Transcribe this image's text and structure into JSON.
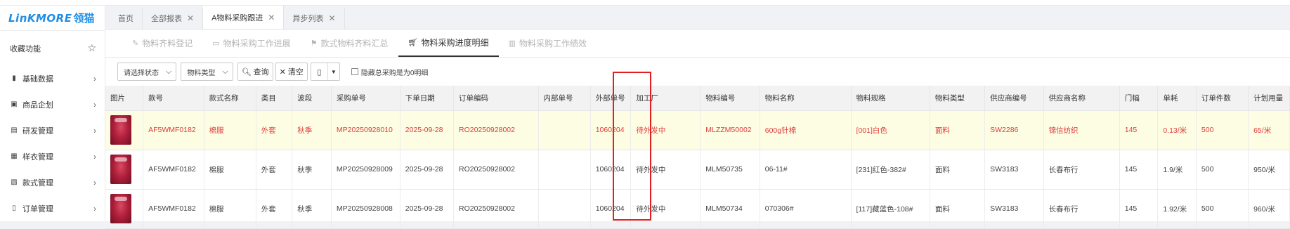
{
  "logo": {
    "brand": "LinKMORE",
    "brand_cn": "领猫"
  },
  "sidebar": {
    "favorite": {
      "label": "收藏功能",
      "icon": "star-icon"
    },
    "items": [
      {
        "label": "基础数据",
        "icon": "book-icon"
      },
      {
        "label": "商品企划",
        "icon": "calendar-icon"
      },
      {
        "label": "研发管理",
        "icon": "rd-icon"
      },
      {
        "label": "样衣管理",
        "icon": "sample-card-icon"
      },
      {
        "label": "款式管理",
        "icon": "style-icon"
      },
      {
        "label": "订单管理",
        "icon": "document-icon"
      }
    ]
  },
  "tabs": [
    {
      "label": "首页",
      "closable": false,
      "active": false
    },
    {
      "label": "全部报表",
      "closable": true,
      "active": false
    },
    {
      "label": "A物料采购跟进",
      "closable": true,
      "active": true
    },
    {
      "label": "异步列表",
      "closable": true,
      "active": false
    }
  ],
  "subtabs": [
    {
      "label": "物料齐料登记",
      "icon": "edit-icon",
      "active": false
    },
    {
      "label": "物料采购工作进展",
      "icon": "monitor-icon",
      "active": false
    },
    {
      "label": "款式物料齐料汇总",
      "icon": "flag-icon",
      "active": false
    },
    {
      "label": "物料采购进度明细",
      "icon": "cart-icon",
      "active": true
    },
    {
      "label": "物料采购工作绩效",
      "icon": "book-open-icon",
      "active": false
    }
  ],
  "toolbar": {
    "status_select": "请选择状态",
    "type_select": "物料类型",
    "query_label": "查询",
    "clear_label": "清空",
    "hide_zero_label": "隐藏总采购是为0明细"
  },
  "table": {
    "columns": [
      "图片",
      "款号",
      "款式名称",
      "类目",
      "波段",
      "采购单号",
      "下单日期",
      "订单编码",
      "内部单号",
      "外部单号",
      "加工厂",
      "物料编号",
      "物料名称",
      "物料规格",
      "物料类型",
      "供应商编号",
      "供应商名称",
      "门幅",
      "单耗",
      "订单件数",
      "计划用量"
    ],
    "rows": [
      {
        "highlight": true,
        "cells": [
          "",
          "AF5WMF0182",
          "棉服",
          "外套",
          "秋季",
          "MP20250928010",
          "2025-09-28",
          "RO20250928002",
          "",
          "1060204",
          "待外发中",
          "MLZZM50002",
          "600g针棉",
          "[001]白色",
          "面料",
          "SW2286",
          "锦信纺织",
          "145",
          "0.13/米",
          "500",
          "65/米"
        ]
      },
      {
        "highlight": false,
        "cells": [
          "",
          "AF5WMF0182",
          "棉服",
          "外套",
          "秋季",
          "MP20250928009",
          "2025-09-28",
          "RO20250928002",
          "",
          "1060204",
          "待外发中",
          "MLM50735",
          "06-11#",
          "[231]红色-382#",
          "面料",
          "SW3183",
          "长春布行",
          "145",
          "1.9/米",
          "500",
          "950/米"
        ]
      },
      {
        "highlight": false,
        "cells": [
          "",
          "AF5WMF0182",
          "棉服",
          "外套",
          "秋季",
          "MP20250928008",
          "2025-09-28",
          "RO20250928002",
          "",
          "1060204",
          "待外发中",
          "MLM50734",
          "070306#",
          "[117]藏蓝色-108#",
          "面料",
          "SW3183",
          "长春布行",
          "145",
          "1.92/米",
          "500",
          "960/米"
        ]
      }
    ]
  },
  "colors": {
    "brand": "#1f8ee6",
    "highlight_row_bg": "#fdfde3",
    "highlight_text": "#e03c3c",
    "annotation_box": "#e02020"
  }
}
